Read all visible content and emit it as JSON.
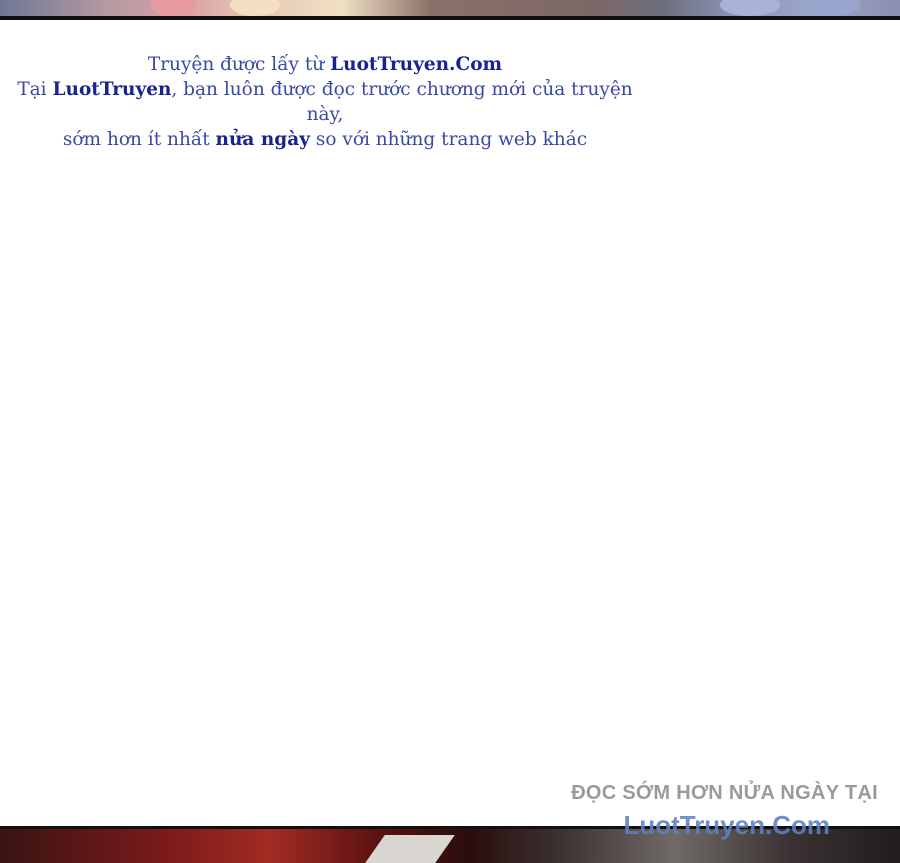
{
  "notice": {
    "line1_prefix": "Truyện được lấy từ ",
    "line1_site": "LuotTruyen.Com",
    "line2_prefix": "Tại ",
    "line2_site": "LuotTruyen",
    "line2_suffix": ", bạn luôn được đọc trước chương mới của truyện này,",
    "line3_prefix": "sớm hơn ít nhất ",
    "line3_highlight": "nửa ngày",
    "line3_suffix": " so với những trang web khác"
  },
  "promo": {
    "line1": "ĐỌC SỚM HƠN NỬA NGÀY TẠI",
    "line2": "LuotTruyen.Com"
  },
  "colors": {
    "notice_text": "#3a49a6",
    "notice_bold": "#1a2290",
    "promo_grey": "#9a9a9a",
    "promo_blue": "#5c80c4"
  }
}
